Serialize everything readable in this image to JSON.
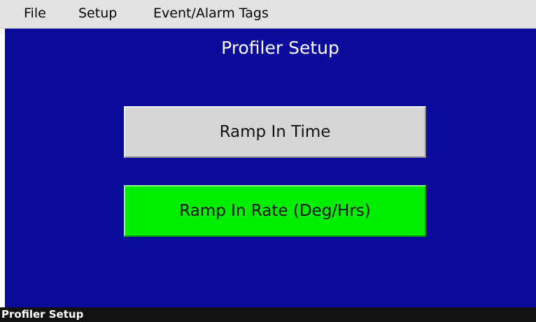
{
  "menubar": {
    "items": [
      {
        "label": "File"
      },
      {
        "label": "Setup"
      },
      {
        "label": "Event/Alarm Tags"
      }
    ]
  },
  "main": {
    "title": "Profiler Setup",
    "buttons": [
      {
        "label": "Ramp In Time",
        "color": "#d6d6d6",
        "state": "unselected"
      },
      {
        "label": "Ramp In Rate (Deg/Hrs)",
        "color": "#00ef00",
        "state": "selected"
      }
    ],
    "background_color": "#0b0b9b"
  },
  "status_bar": {
    "text": "Profiler Setup"
  }
}
